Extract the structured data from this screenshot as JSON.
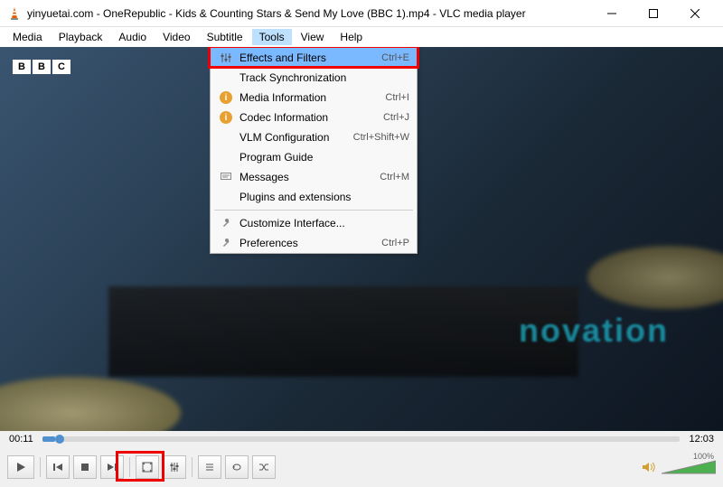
{
  "window": {
    "title": "yinyuetai.com - OneRepublic - Kids & Counting Stars & Send My Love (BBC 1).mp4 - VLC media player"
  },
  "menubar": {
    "items": [
      "Media",
      "Playback",
      "Audio",
      "Video",
      "Subtitle",
      "Tools",
      "View",
      "Help"
    ],
    "open_index": 5
  },
  "tools_menu": {
    "items": [
      {
        "label": "Effects and Filters",
        "shortcut": "Ctrl+E",
        "icon": "sliders",
        "highlight": true
      },
      {
        "label": "Track Synchronization",
        "shortcut": "",
        "icon": ""
      },
      {
        "label": "Media Information",
        "shortcut": "Ctrl+I",
        "icon": "info"
      },
      {
        "label": "Codec Information",
        "shortcut": "Ctrl+J",
        "icon": "info"
      },
      {
        "label": "VLM Configuration",
        "shortcut": "Ctrl+Shift+W",
        "icon": ""
      },
      {
        "label": "Program Guide",
        "shortcut": "",
        "icon": ""
      },
      {
        "label": "Messages",
        "shortcut": "Ctrl+M",
        "icon": "messages"
      },
      {
        "label": "Plugins and extensions",
        "shortcut": "",
        "icon": ""
      },
      {
        "sep": true
      },
      {
        "label": "Customize Interface...",
        "shortcut": "",
        "icon": "wrench"
      },
      {
        "label": "Preferences",
        "shortcut": "Ctrl+P",
        "icon": "wrench"
      }
    ]
  },
  "video": {
    "watermark": [
      "B",
      "B",
      "C"
    ],
    "brand_text": "novation"
  },
  "time": {
    "current": "00:11",
    "total": "12:03"
  },
  "volume": {
    "percent": "100%"
  }
}
